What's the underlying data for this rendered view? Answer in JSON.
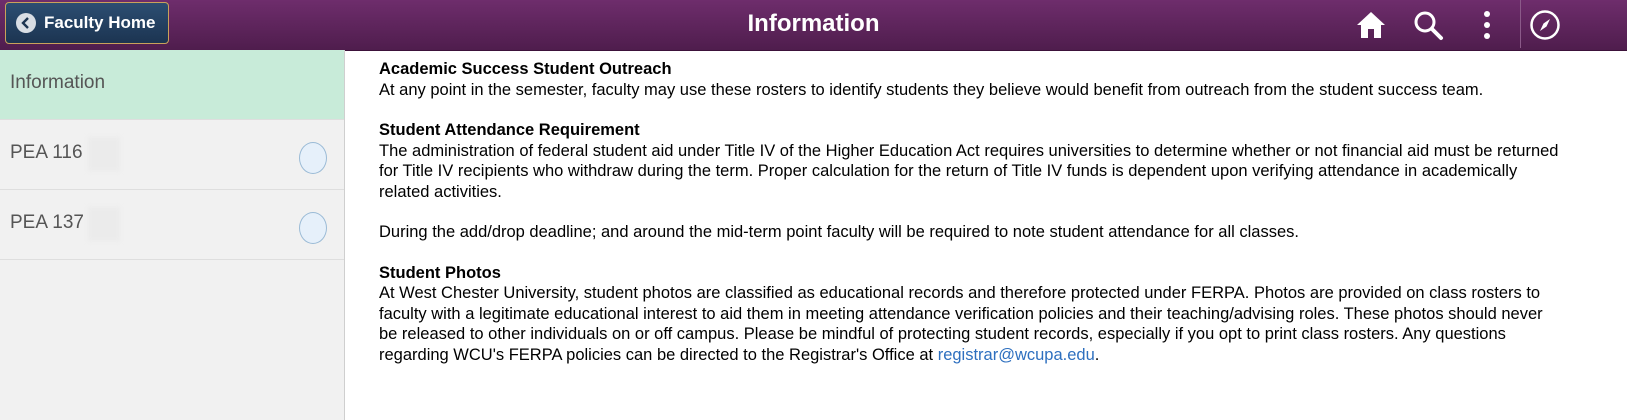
{
  "header": {
    "back_label": "Faculty Home",
    "title": "Information",
    "icons": [
      "home-icon",
      "search-icon",
      "more-icon",
      "navbar-compass-icon"
    ]
  },
  "sidebar": {
    "items": [
      {
        "label": "Information",
        "active": true
      },
      {
        "label": "PEA 116"
      },
      {
        "label": "PEA 137"
      }
    ]
  },
  "content": {
    "outreach": {
      "heading": "Academic Success Student Outreach",
      "text": "At any point in the semester, faculty may use these rosters to identify students they believe would benefit from outreach from the student success team."
    },
    "attendance": {
      "heading": "Student Attendance Requirement",
      "text": "The administration of federal student aid under Title IV of the Higher Education Act requires universities to determine whether or not financial aid must be returned for Title IV recipients who withdraw during the term. Proper calculation for the return of Title IV funds is dependent upon verifying attendance in academically related activities.",
      "text2": "During the add/drop deadline; and around the mid-term point faculty will be required to note student attendance for all classes."
    },
    "photos": {
      "heading": "Student Photos",
      "text": "At West Chester University, student photos are classified as educational records and therefore protected under FERPA. Photos are provided on class rosters to faculty with a legitimate educational interest to aid them in meeting attendance verification policies and their teaching/advising roles. These photos should never be released to other individuals on or off campus. Please be mindful of protecting student records, especially if you opt to print class rosters. Any questions regarding WCU's FERPA policies can be directed to the Registrar's Office at",
      "email": "registrar@wcupa.edu",
      "end": "."
    }
  },
  "colors": {
    "header_bg": "#5e2459",
    "back_button_bg": "#223d5e",
    "active_item_bg": "#c8ebd9",
    "link": "#2d6fbf"
  }
}
